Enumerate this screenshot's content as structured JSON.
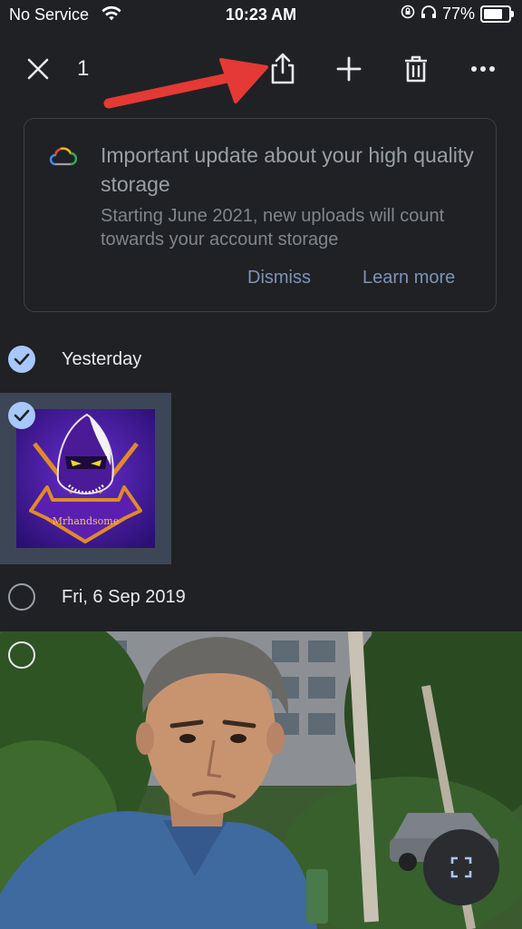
{
  "status_bar": {
    "carrier": "No Service",
    "time": "10:23 AM",
    "battery": "77%"
  },
  "toolbar": {
    "selected_count": "1"
  },
  "banner": {
    "title": "Important update about your high quality storage",
    "body": "Starting June 2021, new uploads will count towards your account storage",
    "dismiss_label": "Dismiss",
    "learn_more_label": "Learn more"
  },
  "sections": [
    {
      "date": "Yesterday",
      "selected": true,
      "thumbnail_caption": "Mrhandsome"
    },
    {
      "date": "Fri, 6 Sep 2019",
      "selected": false
    }
  ],
  "colors": {
    "background": "#202124",
    "accent": "#a8c7fa",
    "link": "#7c93b8",
    "arrow": "#e53935"
  }
}
